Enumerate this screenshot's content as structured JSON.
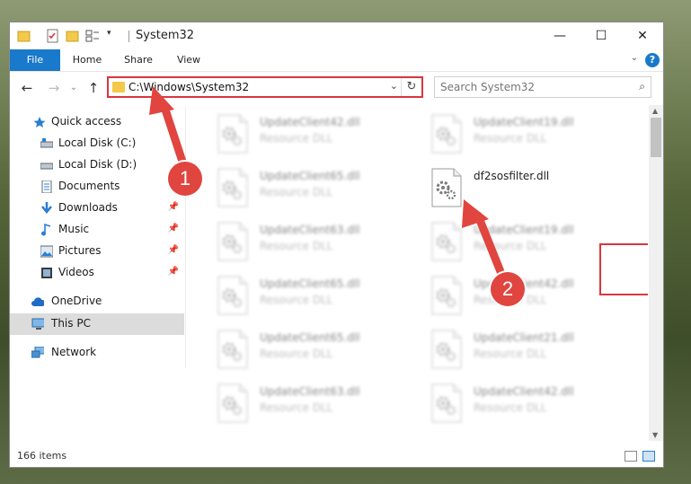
{
  "window": {
    "title": "System32",
    "controls": {
      "minimize": "—",
      "maximize": "☐",
      "close": "✕"
    }
  },
  "ribbon": {
    "tabs": [
      "File",
      "Home",
      "Share",
      "View"
    ],
    "help": "?",
    "caret": "⌄"
  },
  "nav": {
    "back": "←",
    "forward": "→",
    "recent": "⌄",
    "up": "↑",
    "address": "C:\\Windows\\System32",
    "address_chevron": "⌄",
    "refresh": "↻",
    "search_placeholder": "Search System32",
    "search_icon": "⌕"
  },
  "sidebar": {
    "items": [
      {
        "label": "Quick access",
        "icon": "star-icon",
        "pinned": false
      },
      {
        "label": "Local Disk (C:)",
        "icon": "drive-icon",
        "pinned": false
      },
      {
        "label": "Local Disk (D:)",
        "icon": "drive-icon",
        "pinned": false
      },
      {
        "label": "Documents",
        "icon": "documents-icon",
        "pinned": true
      },
      {
        "label": "Downloads",
        "icon": "download-icon",
        "pinned": true
      },
      {
        "label": "Music",
        "icon": "music-icon",
        "pinned": true
      },
      {
        "label": "Pictures",
        "icon": "pictures-icon",
        "pinned": true
      },
      {
        "label": "Videos",
        "icon": "videos-icon",
        "pinned": true
      },
      {
        "label": "OneDrive",
        "icon": "cloud-icon",
        "pinned": false
      },
      {
        "label": "This PC",
        "icon": "computer-icon",
        "pinned": false,
        "selected": true
      },
      {
        "label": "Network",
        "icon": "network-icon",
        "pinned": false
      }
    ],
    "pin_glyph": "📌"
  },
  "files": {
    "left_column": [
      {
        "name": "UpdateClient42.dll",
        "type": "Resource DLL"
      },
      {
        "name": "UpdateClient65.dll",
        "type": "Resource DLL"
      },
      {
        "name": "UpdateClient63.dll",
        "type": "Resource DLL"
      },
      {
        "name": "UpdateClient65.dll",
        "type": "Resource DLL"
      },
      {
        "name": "UpdateClient65.dll",
        "type": "Resource DLL"
      },
      {
        "name": "UpdateClient63.dll",
        "type": "Resource DLL"
      }
    ],
    "right_column": [
      {
        "name": "UpdateClient19.dll",
        "type": "Resource DLL",
        "blurred": true
      },
      {
        "name": "df2sosfilter.dll",
        "type": "",
        "blurred": false,
        "highlighted": true
      },
      {
        "name": "UpdateClient19.dll",
        "type": "Resource DLL",
        "blurred": true
      },
      {
        "name": "UpdateClient42.dll",
        "type": "Resource DLL",
        "blurred": true
      },
      {
        "name": "UpdateClient21.dll",
        "type": "Resource DLL",
        "blurred": true
      },
      {
        "name": "UpdateClient42.dll",
        "type": "Resource DLL",
        "blurred": true
      }
    ]
  },
  "annotations": {
    "step1": "1",
    "step2": "2",
    "highlight_color": "#d9363e"
  },
  "status": {
    "item_count": "166 items"
  },
  "colors": {
    "accent": "#1979ca",
    "annotation_red": "#e0453f",
    "folder_yellow": "#f4c94a"
  }
}
